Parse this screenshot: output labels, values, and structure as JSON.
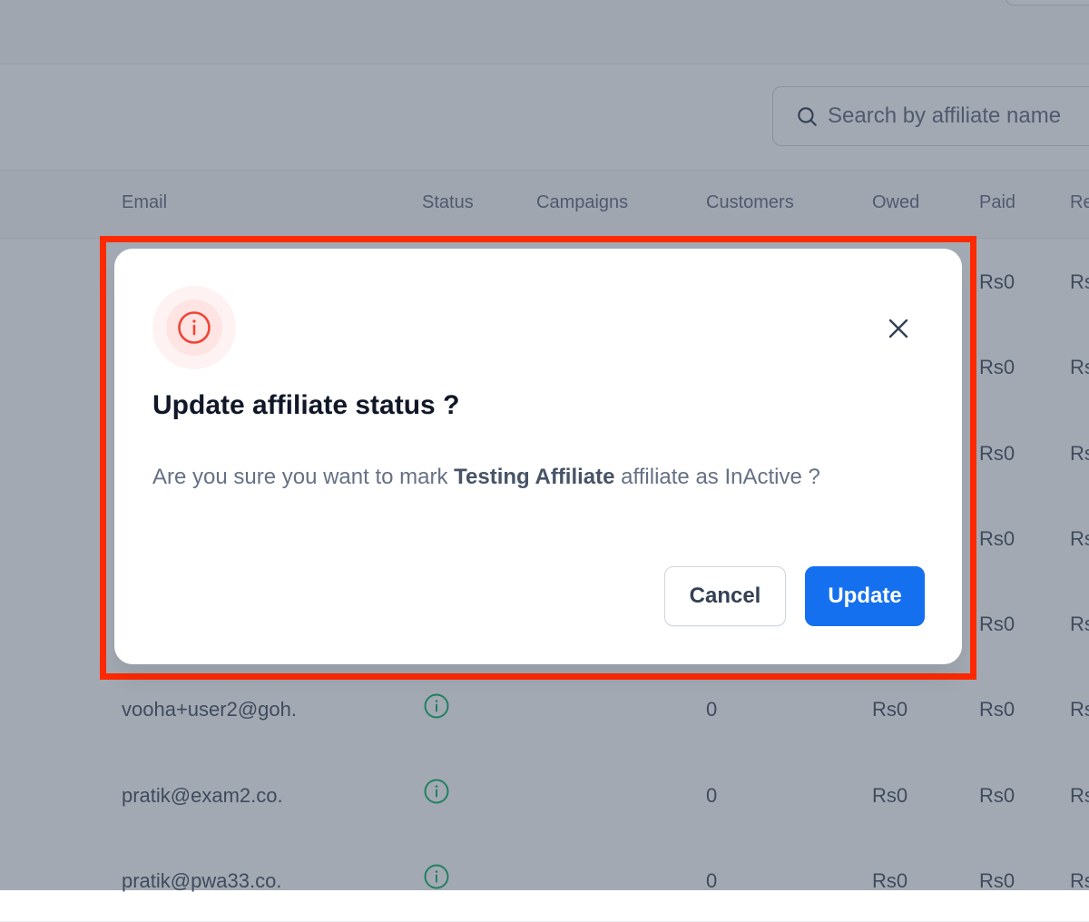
{
  "search": {
    "placeholder": "Search by affiliate name"
  },
  "table": {
    "headers": [
      "Email",
      "Status",
      "Campaigns",
      "Customers",
      "Owed",
      "Paid",
      "Re"
    ],
    "rows": [
      {
        "email": "",
        "customers": "",
        "owed": "",
        "paid": "Rs0",
        "extra": "Rs"
      },
      {
        "email": "",
        "customers": "",
        "owed": "",
        "paid": "Rs0",
        "extra": "Rs"
      },
      {
        "email": "",
        "customers": "",
        "owed": "",
        "paid": "Rs0",
        "extra": "Rs"
      },
      {
        "email": "",
        "customers": "",
        "owed": "",
        "paid": "Rs0",
        "extra": "Rs"
      },
      {
        "email": "",
        "customers": "",
        "owed": "",
        "paid": "Rs0",
        "extra": "Rs"
      },
      {
        "email": "vooha+user2@goh.",
        "customers": "0",
        "owed": "Rs0",
        "paid": "Rs0",
        "extra": "Rs"
      },
      {
        "email": "pratik@exam2.co.",
        "customers": "0",
        "owed": "Rs0",
        "paid": "Rs0",
        "extra": "Rs"
      },
      {
        "email": "pratik@pwa33.co.",
        "customers": "0",
        "owed": "Rs0",
        "paid": "Rs0",
        "extra": "Rs"
      }
    ]
  },
  "modal": {
    "title": "Update affiliate status ?",
    "message_prefix": "Are you sure you want to mark ",
    "affiliate_name": "Testing Affiliate",
    "message_suffix": " affiliate as InActive ?",
    "cancel_label": "Cancel",
    "update_label": "Update",
    "icon": "info-circle-icon",
    "close_icon": "close-icon"
  },
  "colors": {
    "accent": "#1570ef",
    "danger": "#f04438",
    "active_status": "#12b76a",
    "highlight_border": "#ff2a00"
  }
}
